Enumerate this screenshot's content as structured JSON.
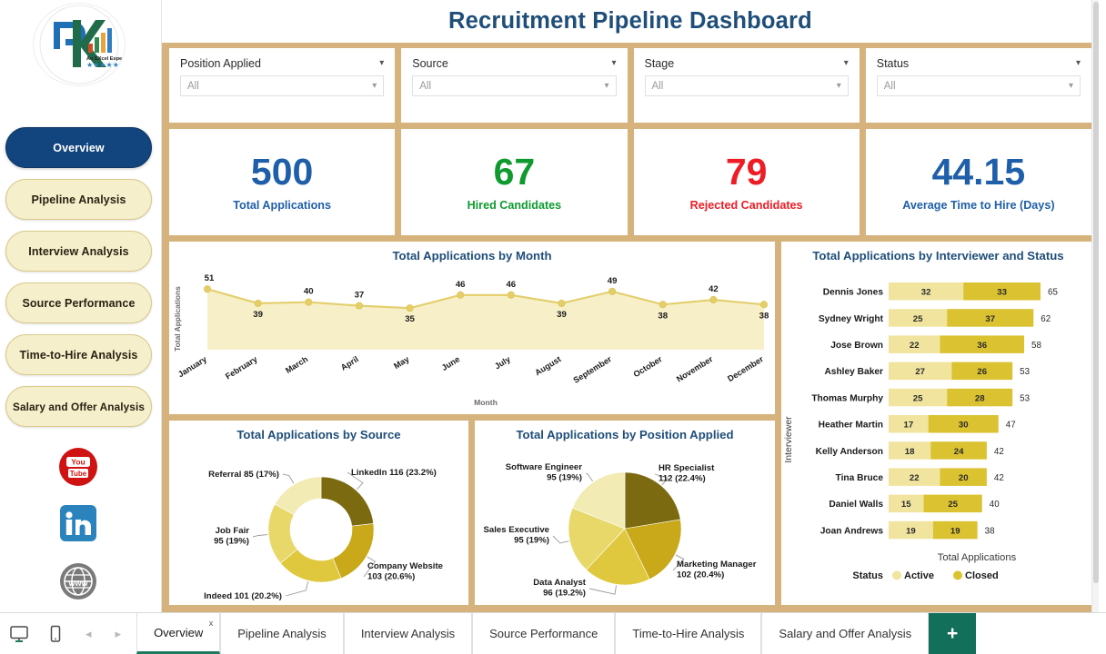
{
  "header": {
    "title": "Recruitment Pipeline Dashboard"
  },
  "brand": {
    "logo_name": "pk-excel-expert-logo",
    "logo_tagline": "An EXcel Expert",
    "logo_letters": "PK"
  },
  "sidebar": {
    "items": [
      {
        "label": "Overview",
        "active": true
      },
      {
        "label": "Pipeline Analysis",
        "active": false
      },
      {
        "label": "Interview Analysis",
        "active": false
      },
      {
        "label": "Source Performance",
        "active": false
      },
      {
        "label": "Time-to-Hire Analysis",
        "active": false
      },
      {
        "label": "Salary and Offer Analysis",
        "active": false
      }
    ],
    "social": [
      {
        "name": "youtube-icon",
        "color": "#CE1312"
      },
      {
        "name": "linkedin-icon",
        "color": "#2A83BC"
      },
      {
        "name": "website-icon",
        "color": "#777777"
      }
    ]
  },
  "filters": [
    {
      "label": "Position Applied",
      "value": "All"
    },
    {
      "label": "Source",
      "value": "All"
    },
    {
      "label": "Stage",
      "value": "All"
    },
    {
      "label": "Status",
      "value": "All"
    }
  ],
  "kpis": [
    {
      "value": "500",
      "label": "Total Applications",
      "color": "#1F5FA9"
    },
    {
      "value": "67",
      "label": "Hired Candidates",
      "color": "#0E9A2E"
    },
    {
      "value": "79",
      "label": "Rejected Candidates",
      "color": "#EE1C25"
    },
    {
      "value": "44.15",
      "label": "Average Time to Hire (Days)",
      "color": "#1F5FA9"
    }
  ],
  "colors": {
    "canvas": "#D6B37C",
    "title_blue": "#1F4E79",
    "active_nav": "#12457E",
    "nav_cream": "#F5EFCB",
    "series_light": "#EFE3A0",
    "series_gold": "#DCC233",
    "gold_line": "#E8D98A",
    "add_sheet_green": "#12705A"
  },
  "chart_data": [
    {
      "type": "area",
      "title": "Total Applications by Month",
      "xlabel": "Month",
      "ylabel": "Total Applications",
      "categories": [
        "January",
        "February",
        "March",
        "April",
        "May",
        "June",
        "July",
        "August",
        "September",
        "October",
        "November",
        "December"
      ],
      "values": [
        51,
        39,
        40,
        37,
        35,
        46,
        46,
        39,
        49,
        38,
        42,
        38
      ],
      "ylim": [
        0,
        55
      ],
      "grid": false,
      "legend": "none",
      "marker_color": "#E3CE6B",
      "fill_color": "#F7EFC8"
    },
    {
      "type": "bar",
      "title": "Total Applications by Interviewer and Status",
      "orientation": "horizontal",
      "stacked": true,
      "xlabel": "Total Applications",
      "ylabel": "Interviewer",
      "legend_title": "Status",
      "legend_position": "bottom",
      "categories": [
        "Dennis Jones",
        "Sydney Wright",
        "Jose Brown",
        "Ashley Baker",
        "Thomas Murphy",
        "Heather Martin",
        "Kelly Anderson",
        "Tina Bruce",
        "Daniel Walls",
        "Joan Andrews"
      ],
      "series": [
        {
          "name": "Active",
          "color": "#F0E49F",
          "values": [
            32,
            25,
            22,
            27,
            25,
            17,
            18,
            22,
            15,
            19
          ]
        },
        {
          "name": "Closed",
          "color": "#DBC231",
          "values": [
            33,
            37,
            36,
            26,
            28,
            30,
            24,
            20,
            25,
            19
          ]
        }
      ],
      "totals": [
        65,
        62,
        58,
        53,
        53,
        47,
        42,
        42,
        40,
        38
      ],
      "xlim": [
        0,
        65
      ]
    },
    {
      "type": "pie",
      "variant": "donut",
      "title": "Total Applications by Source",
      "labels": [
        "LinkedIn",
        "Company Website",
        "Indeed",
        "Job Fair",
        "Referral"
      ],
      "values": [
        116,
        103,
        101,
        95,
        85
      ],
      "percents": [
        "23.2%",
        "20.6%",
        "20.2%",
        "19%",
        "17%"
      ],
      "label_texts": [
        "LinkedIn 116 (23.2%)",
        "Company Website 103 (20.6%)",
        "Indeed 101 (20.2%)",
        "Job Fair 95 (19%)",
        "Referral 85 (17%)"
      ],
      "colors": [
        "#7C6A10",
        "#C9A81A",
        "#DFC83E",
        "#E8D869",
        "#F2EBB4"
      ]
    },
    {
      "type": "pie",
      "title": "Total Applications by Position Applied",
      "labels": [
        "HR Specialist",
        "Marketing Manager",
        "Data Analyst",
        "Sales Executive",
        "Software Engineer"
      ],
      "values": [
        112,
        102,
        96,
        95,
        95
      ],
      "percents": [
        "22.4%",
        "20.4%",
        "19.2%",
        "19%",
        "19%"
      ],
      "label_texts": [
        "HR Specialist 112 (22.4%)",
        "Marketing Manager 102 (20.4%)",
        "Data Analyst 96 (19.2%)",
        "Sales Executive 95 (19%)",
        "Software Engineer 95 (19%)"
      ],
      "colors": [
        "#7C6A10",
        "#C9A81A",
        "#DFC83E",
        "#E8D869",
        "#F2EBB4"
      ]
    }
  ],
  "tabbar": {
    "tabs": [
      {
        "label": "Overview",
        "active": true,
        "closable": true
      },
      {
        "label": "Pipeline Analysis",
        "active": false,
        "closable": false
      },
      {
        "label": "Interview Analysis",
        "active": false,
        "closable": false
      },
      {
        "label": "Source Performance",
        "active": false,
        "closable": false
      },
      {
        "label": "Time-to-Hire Analysis",
        "active": false,
        "closable": false
      },
      {
        "label": "Salary and Offer Analysis",
        "active": false,
        "closable": false
      }
    ],
    "close_glyph": "x",
    "add_label": "+",
    "prev_glyph": "◂",
    "next_glyph": "▸"
  }
}
